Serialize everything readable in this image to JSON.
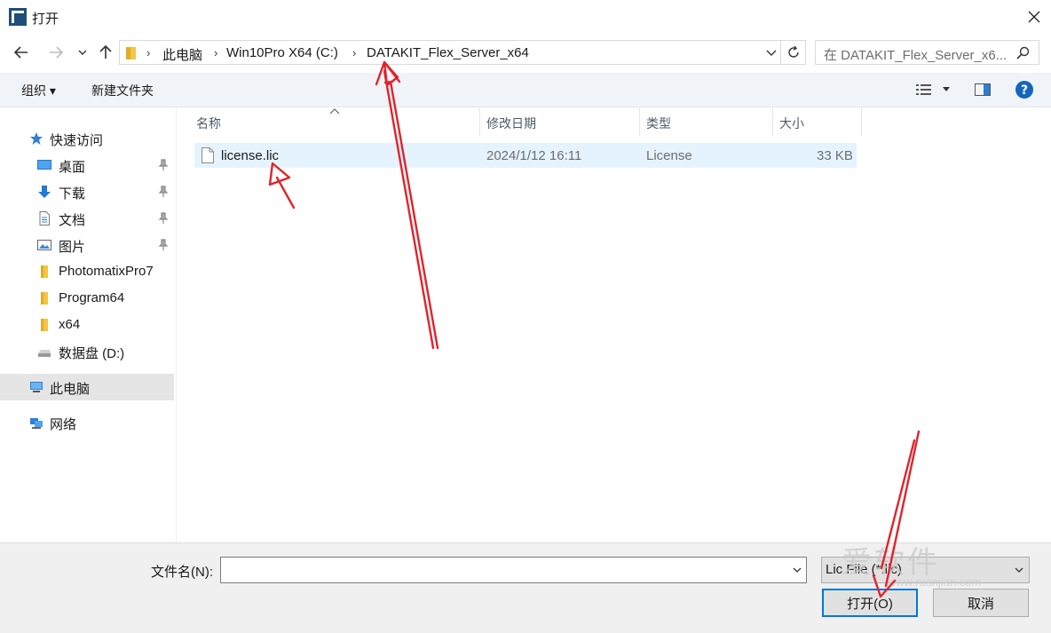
{
  "window": {
    "title": "打开"
  },
  "navigation": {
    "breadcrumbs": [
      "此电脑",
      "Win10Pro X64 (C:)",
      "DATAKIT_Flex_Server_x64"
    ],
    "search_placeholder": "在 DATAKIT_Flex_Server_x6..."
  },
  "toolbar": {
    "organize_label": "组织 ▾",
    "new_folder_label": "新建文件夹"
  },
  "sidebar": {
    "quick_access": "快速访问",
    "items": [
      {
        "label": "桌面",
        "icon": "desktop-icon",
        "pinned": true
      },
      {
        "label": "下载",
        "icon": "download-icon",
        "pinned": true
      },
      {
        "label": "文档",
        "icon": "document-icon",
        "pinned": true
      },
      {
        "label": "图片",
        "icon": "picture-icon",
        "pinned": true
      },
      {
        "label": "PhotomatixPro7",
        "icon": "folder-icon",
        "pinned": false
      },
      {
        "label": "Program64",
        "icon": "folder-icon",
        "pinned": false
      },
      {
        "label": "x64",
        "icon": "folder-icon",
        "pinned": false
      },
      {
        "label": "数据盘 (D:)",
        "icon": "drive-icon",
        "pinned": false
      }
    ],
    "this_pc": "此电脑",
    "network": "网络"
  },
  "file_list": {
    "columns": [
      "名称",
      "修改日期",
      "类型",
      "大小"
    ],
    "rows": [
      {
        "name": "license.lic",
        "modified": "2024/1/12 16:11",
        "type": "License",
        "size": "33 KB"
      }
    ]
  },
  "footer": {
    "filename_label": "文件名(N):",
    "filename_value": "",
    "filetype_value": "Lic File (*.lic)",
    "open_label": "打开(O)",
    "cancel_label": "取消"
  },
  "watermark": {
    "text": "爱软件",
    "url": "www.ruanjian.com"
  },
  "colors": {
    "accent": "#0078d7",
    "selection": "#e5f3ff",
    "annotation": "#e0242c",
    "folder": "#f4c542"
  }
}
